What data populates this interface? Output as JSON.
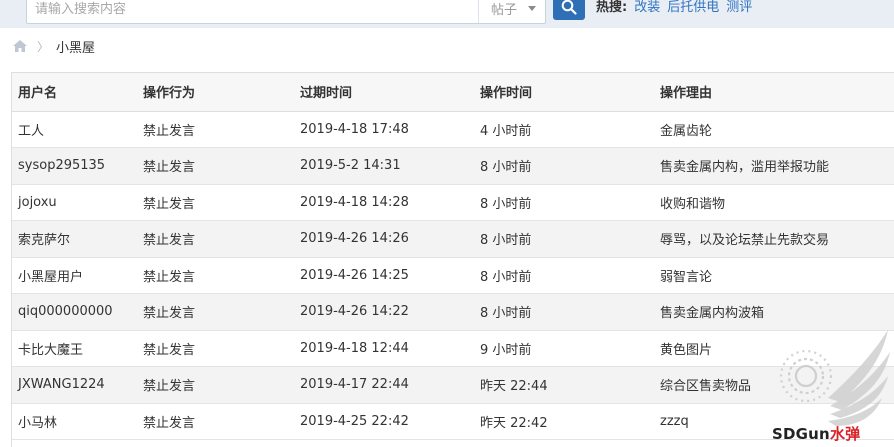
{
  "search": {
    "placeholder": "请输入搜索内容",
    "type_label": "帖子"
  },
  "hot": {
    "label": "热搜:",
    "links": [
      "改装",
      "后托供电",
      "测评"
    ]
  },
  "breadcrumb": {
    "current": "小黑屋"
  },
  "table": {
    "headers": [
      "用户名",
      "操作行为",
      "过期时间",
      "操作时间",
      "操作理由"
    ],
    "rows": [
      [
        "工人",
        "禁止发言",
        "2019-4-18 17:48",
        "4 小时前",
        "金属齿轮"
      ],
      [
        "sysop295135",
        "禁止发言",
        "2019-5-2 14:31",
        "8 小时前",
        "售卖金属内构，滥用举报功能"
      ],
      [
        "jojoxu",
        "禁止发言",
        "2019-4-18 14:28",
        "8 小时前",
        "收购和谐物"
      ],
      [
        "索克萨尔",
        "禁止发言",
        "2019-4-26 14:26",
        "8 小时前",
        "辱骂，以及论坛禁止先款交易"
      ],
      [
        "小黑屋用户",
        "禁止发言",
        "2019-4-26 14:25",
        "8 小时前",
        "弱智言论"
      ],
      [
        "qiq000000000",
        "禁止发言",
        "2019-4-26 14:22",
        "8 小时前",
        "售卖金属内构波箱"
      ],
      [
        "卡比大魔王",
        "禁止发言",
        "2019-4-18 12:44",
        "9 小时前",
        "黄色图片"
      ],
      [
        "JXWANG1224",
        "禁止发言",
        "2019-4-17 22:44",
        "昨天 22:44",
        "综合区售卖物品"
      ],
      [
        "小马林",
        "禁止发言",
        "2019-4-25 22:42",
        "昨天 22:42",
        "zzzq"
      ]
    ]
  },
  "watermark": {
    "text_main": "SDGun",
    "text_accent": "水弹"
  },
  "colors": {
    "accent": "#2e6fb5",
    "link": "#2f73c0",
    "topbar": "#e9eef5",
    "row_alt": "#f3f3f3",
    "watermark_red": "#d8232a"
  },
  "icons": [
    "search-icon",
    "home-icon",
    "chevron-down-icon",
    "chevron-right-icon",
    "sdgun-logo-icon"
  ]
}
